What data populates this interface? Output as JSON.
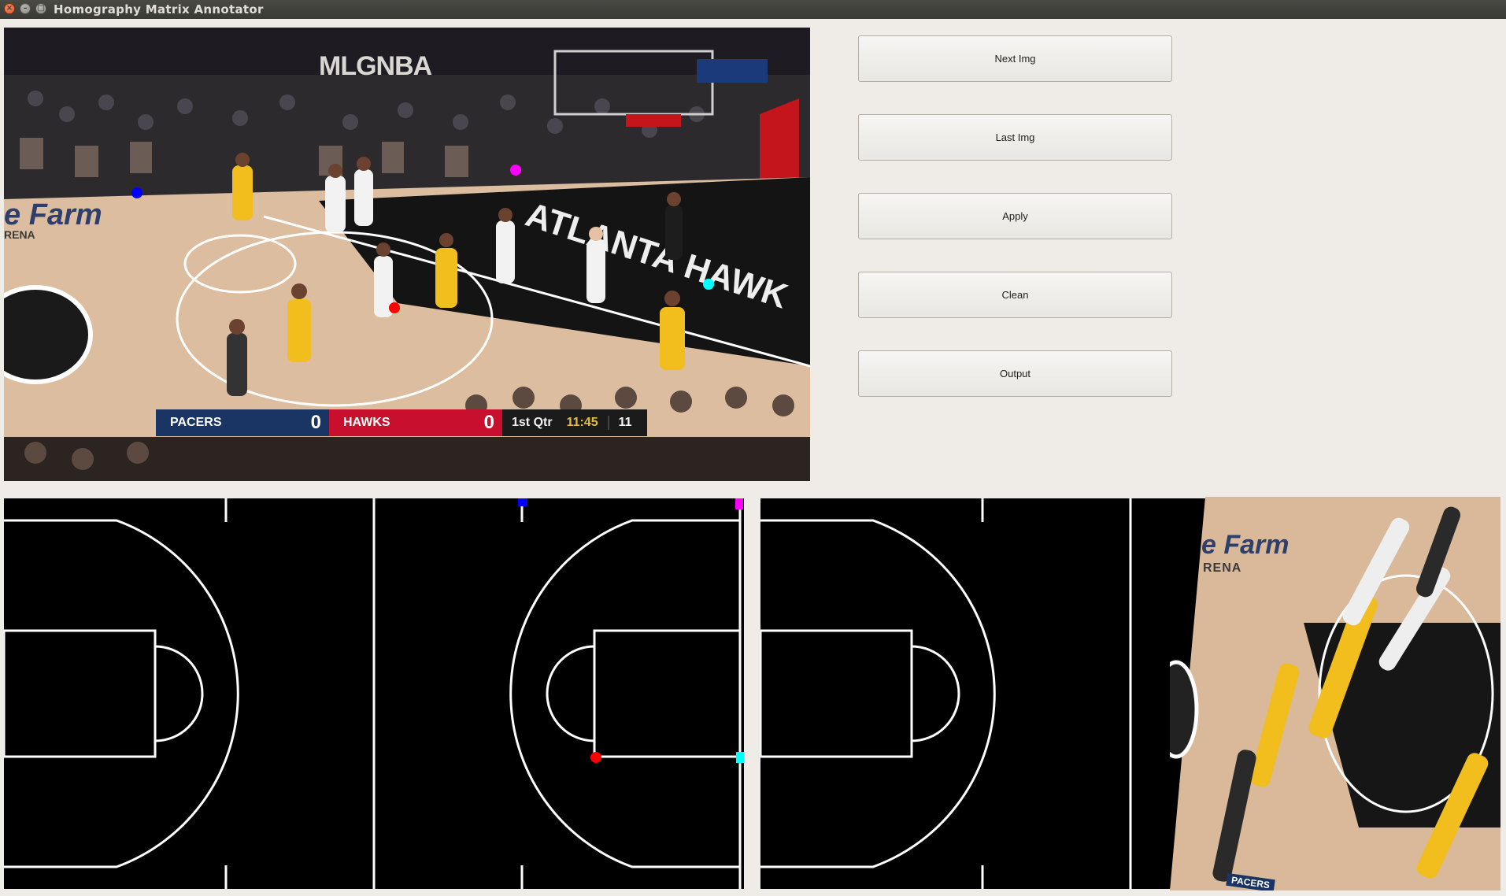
{
  "window": {
    "title": "Homography Matrix Annotator"
  },
  "frame": {
    "logo_text": "MLGNBA",
    "scoreboard": {
      "home_team": "PACERS",
      "home_score": "0",
      "away_team": "HAWKS",
      "away_score": "0",
      "quarter": "1st Qtr",
      "clock": "11:45",
      "shot_clock": "11"
    },
    "markers": [
      {
        "color": "#0000ff",
        "name": "blue"
      },
      {
        "color": "#ff00ff",
        "name": "magenta"
      },
      {
        "color": "#ff0000",
        "name": "red"
      },
      {
        "color": "#00ffff",
        "name": "cyan"
      }
    ]
  },
  "buttons": {
    "next": "Next Img",
    "last": "Last Img",
    "apply": "Apply",
    "clean": "Clean",
    "output": "Output"
  },
  "warp_preview": {
    "sponsor_text": "e Farm",
    "arena_text": "RENA",
    "scorebug_text": "PACERS"
  },
  "colors": {
    "court_lines": "#ffffff",
    "court_bg": "#000000",
    "floor": "#d9b99a"
  }
}
